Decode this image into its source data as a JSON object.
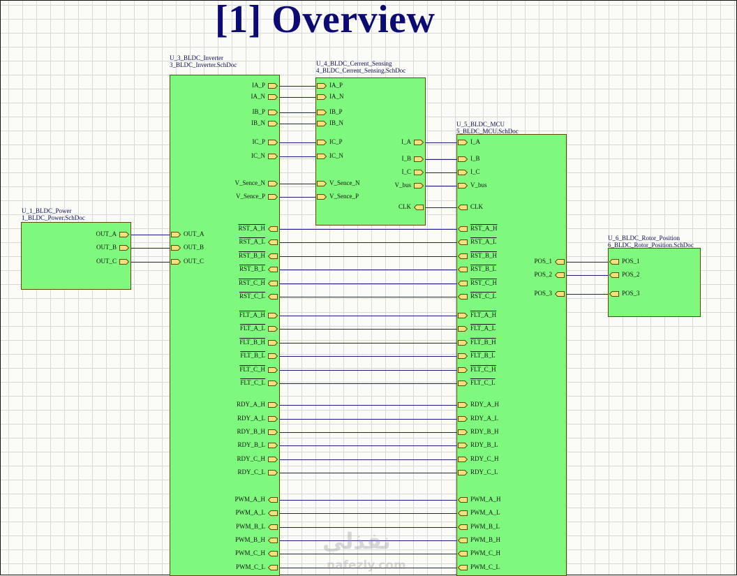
{
  "title": "[1] Overview",
  "colors": {
    "block_fill": "#7ef97e",
    "wire": "#1a1a8a",
    "port_fill": "#f6e07a",
    "title": "#0b0b73"
  },
  "blocks": [
    {
      "id": "power",
      "designator": "U_1_BLDC_Power",
      "filename": "1_BLDC_Power.SchDoc",
      "ports": [
        {
          "name": "OUT_A",
          "side": "right",
          "dir": "out",
          "overline": false
        },
        {
          "name": "OUT_B",
          "side": "right",
          "dir": "out",
          "overline": false
        },
        {
          "name": "OUT_C",
          "side": "right",
          "dir": "out",
          "overline": false
        }
      ]
    },
    {
      "id": "inverter",
      "designator": "U_3_BLDC_Inverter",
      "filename": "3_BLDC_Inverter.SchDoc",
      "ports": [
        {
          "name": "OUT_A",
          "side": "left",
          "dir": "in",
          "overline": false
        },
        {
          "name": "OUT_B",
          "side": "left",
          "dir": "in",
          "overline": false
        },
        {
          "name": "OUT_C",
          "side": "left",
          "dir": "in",
          "overline": false
        },
        {
          "name": "IA_P",
          "side": "right",
          "dir": "out",
          "overline": false
        },
        {
          "name": "IA_N",
          "side": "right",
          "dir": "out",
          "overline": false
        },
        {
          "name": "IB_P",
          "side": "right",
          "dir": "out",
          "overline": false
        },
        {
          "name": "IB_N",
          "side": "right",
          "dir": "out",
          "overline": false
        },
        {
          "name": "IC_P",
          "side": "right",
          "dir": "out",
          "overline": false
        },
        {
          "name": "IC_N",
          "side": "right",
          "dir": "out",
          "overline": false
        },
        {
          "name": "V_Sence_N",
          "side": "right",
          "dir": "out",
          "overline": false
        },
        {
          "name": "V_Sence_P",
          "side": "right",
          "dir": "out",
          "overline": false
        },
        {
          "name": "RST_A_H",
          "side": "right",
          "dir": "in",
          "overline": true
        },
        {
          "name": "RST_A_L",
          "side": "right",
          "dir": "in",
          "overline": true
        },
        {
          "name": "RST_B_H",
          "side": "right",
          "dir": "in",
          "overline": true
        },
        {
          "name": "RST_B_L",
          "side": "right",
          "dir": "in",
          "overline": true
        },
        {
          "name": "RST_C_H",
          "side": "right",
          "dir": "in",
          "overline": true
        },
        {
          "name": "RST_C_L",
          "side": "right",
          "dir": "in",
          "overline": true
        },
        {
          "name": "FLT_A_H",
          "side": "right",
          "dir": "out",
          "overline": true
        },
        {
          "name": "FLT_A_L",
          "side": "right",
          "dir": "out",
          "overline": true
        },
        {
          "name": "FLT_B_H",
          "side": "right",
          "dir": "out",
          "overline": true
        },
        {
          "name": "FLT_B_L",
          "side": "right",
          "dir": "out",
          "overline": true
        },
        {
          "name": "FLT_C_H",
          "side": "right",
          "dir": "out",
          "overline": true
        },
        {
          "name": "FLT_C_L",
          "side": "right",
          "dir": "out",
          "overline": true
        },
        {
          "name": "RDY_A_H",
          "side": "right",
          "dir": "out",
          "overline": false
        },
        {
          "name": "RDY_A_L",
          "side": "right",
          "dir": "out",
          "overline": false
        },
        {
          "name": "RDY_B_H",
          "side": "right",
          "dir": "out",
          "overline": false
        },
        {
          "name": "RDY_B_L",
          "side": "right",
          "dir": "out",
          "overline": false
        },
        {
          "name": "RDY_C_H",
          "side": "right",
          "dir": "out",
          "overline": false
        },
        {
          "name": "RDY_C_L",
          "side": "right",
          "dir": "out",
          "overline": false
        },
        {
          "name": "PWM_A_H",
          "side": "right",
          "dir": "in",
          "overline": false
        },
        {
          "name": "PWM_A_L",
          "side": "right",
          "dir": "in",
          "overline": false
        },
        {
          "name": "PWM_B_L",
          "side": "right",
          "dir": "in",
          "overline": false
        },
        {
          "name": "PWM_B_H",
          "side": "right",
          "dir": "in",
          "overline": false
        },
        {
          "name": "PWM_C_H",
          "side": "right",
          "dir": "in",
          "overline": false
        },
        {
          "name": "PWM_C_L",
          "side": "right",
          "dir": "in",
          "overline": false
        }
      ]
    },
    {
      "id": "sensing",
      "designator": "U_4_BLDC_Cerrent_Sensing",
      "filename": "4_BLDC_Cerrent_Sensing.SchDoc",
      "ports": [
        {
          "name": "IA_P",
          "side": "left",
          "dir": "in",
          "overline": false
        },
        {
          "name": "IA_N",
          "side": "left",
          "dir": "in",
          "overline": false
        },
        {
          "name": "IB_P",
          "side": "left",
          "dir": "in",
          "overline": false
        },
        {
          "name": "IB_N",
          "side": "left",
          "dir": "in",
          "overline": false
        },
        {
          "name": "IC_P",
          "side": "left",
          "dir": "in",
          "overline": false
        },
        {
          "name": "IC_N",
          "side": "left",
          "dir": "in",
          "overline": false
        },
        {
          "name": "V_Sence_N",
          "side": "left",
          "dir": "in",
          "overline": false
        },
        {
          "name": "V_Sence_P",
          "side": "left",
          "dir": "in",
          "overline": false
        },
        {
          "name": "I_A",
          "side": "right",
          "dir": "out",
          "overline": false
        },
        {
          "name": "I_B",
          "side": "right",
          "dir": "out",
          "overline": false
        },
        {
          "name": "I_C",
          "side": "right",
          "dir": "out",
          "overline": false
        },
        {
          "name": "V_bus",
          "side": "right",
          "dir": "out",
          "overline": false
        },
        {
          "name": "CLK",
          "side": "right",
          "dir": "in",
          "overline": false
        }
      ]
    },
    {
      "id": "mcu",
      "designator": "U_5_BLDC_MCU",
      "filename": "5_BLDC_MCU.SchDoc",
      "ports": [
        {
          "name": "I_A",
          "side": "left",
          "dir": "in",
          "overline": false
        },
        {
          "name": "I_B",
          "side": "left",
          "dir": "in",
          "overline": false
        },
        {
          "name": "I_C",
          "side": "left",
          "dir": "in",
          "overline": false
        },
        {
          "name": "V_bus",
          "side": "left",
          "dir": "in",
          "overline": false
        },
        {
          "name": "CLK",
          "side": "left",
          "dir": "out",
          "overline": false
        },
        {
          "name": "RST_A_H",
          "side": "left",
          "dir": "out",
          "overline": true
        },
        {
          "name": "RST_A_L",
          "side": "left",
          "dir": "out",
          "overline": true
        },
        {
          "name": "RST_B_H",
          "side": "left",
          "dir": "out",
          "overline": true
        },
        {
          "name": "RST_B_L",
          "side": "left",
          "dir": "out",
          "overline": true
        },
        {
          "name": "RST_C_H",
          "side": "left",
          "dir": "out",
          "overline": true
        },
        {
          "name": "RST_C_L",
          "side": "left",
          "dir": "out",
          "overline": true
        },
        {
          "name": "FLT_A_H",
          "side": "left",
          "dir": "in",
          "overline": true
        },
        {
          "name": "FLT_A_L",
          "side": "left",
          "dir": "in",
          "overline": true
        },
        {
          "name": "FLT_B_H",
          "side": "left",
          "dir": "in",
          "overline": true
        },
        {
          "name": "FLT_B_L",
          "side": "left",
          "dir": "in",
          "overline": true
        },
        {
          "name": "FLT_C_H",
          "side": "left",
          "dir": "in",
          "overline": true
        },
        {
          "name": "FLT_C_L",
          "side": "left",
          "dir": "in",
          "overline": true
        },
        {
          "name": "RDY_A_H",
          "side": "left",
          "dir": "in",
          "overline": false
        },
        {
          "name": "RDY_A_L",
          "side": "left",
          "dir": "in",
          "overline": false
        },
        {
          "name": "RDY_B_H",
          "side": "left",
          "dir": "in",
          "overline": false
        },
        {
          "name": "RDY_B_L",
          "side": "left",
          "dir": "in",
          "overline": false
        },
        {
          "name": "RDY_C_H",
          "side": "left",
          "dir": "in",
          "overline": false
        },
        {
          "name": "RDY_C_L",
          "side": "left",
          "dir": "in",
          "overline": false
        },
        {
          "name": "PWM_A_H",
          "side": "left",
          "dir": "out",
          "overline": false
        },
        {
          "name": "PWM_A_L",
          "side": "left",
          "dir": "out",
          "overline": false
        },
        {
          "name": "PWM_B_L",
          "side": "left",
          "dir": "out",
          "overline": false
        },
        {
          "name": "PWM_B_H",
          "side": "left",
          "dir": "out",
          "overline": false
        },
        {
          "name": "PWM_C_H",
          "side": "left",
          "dir": "out",
          "overline": false
        },
        {
          "name": "PWM_C_L",
          "side": "left",
          "dir": "out",
          "overline": false
        },
        {
          "name": "POS_1",
          "side": "right",
          "dir": "in",
          "overline": false
        },
        {
          "name": "POS_2",
          "side": "right",
          "dir": "in",
          "overline": false
        },
        {
          "name": "POS_3",
          "side": "right",
          "dir": "in",
          "overline": false
        }
      ]
    },
    {
      "id": "rotor",
      "designator": "U_6_BLDC_Rotor_Position",
      "filename": "6_BLDC_Rotor_Position.SchDoc",
      "ports": [
        {
          "name": "POS_1",
          "side": "left",
          "dir": "out",
          "overline": false
        },
        {
          "name": "POS_2",
          "side": "left",
          "dir": "out",
          "overline": false
        },
        {
          "name": "POS_3",
          "side": "left",
          "dir": "out",
          "overline": false
        }
      ]
    }
  ],
  "watermark": {
    "arabic": "نفذلي",
    "latin": "nafezly.com"
  }
}
